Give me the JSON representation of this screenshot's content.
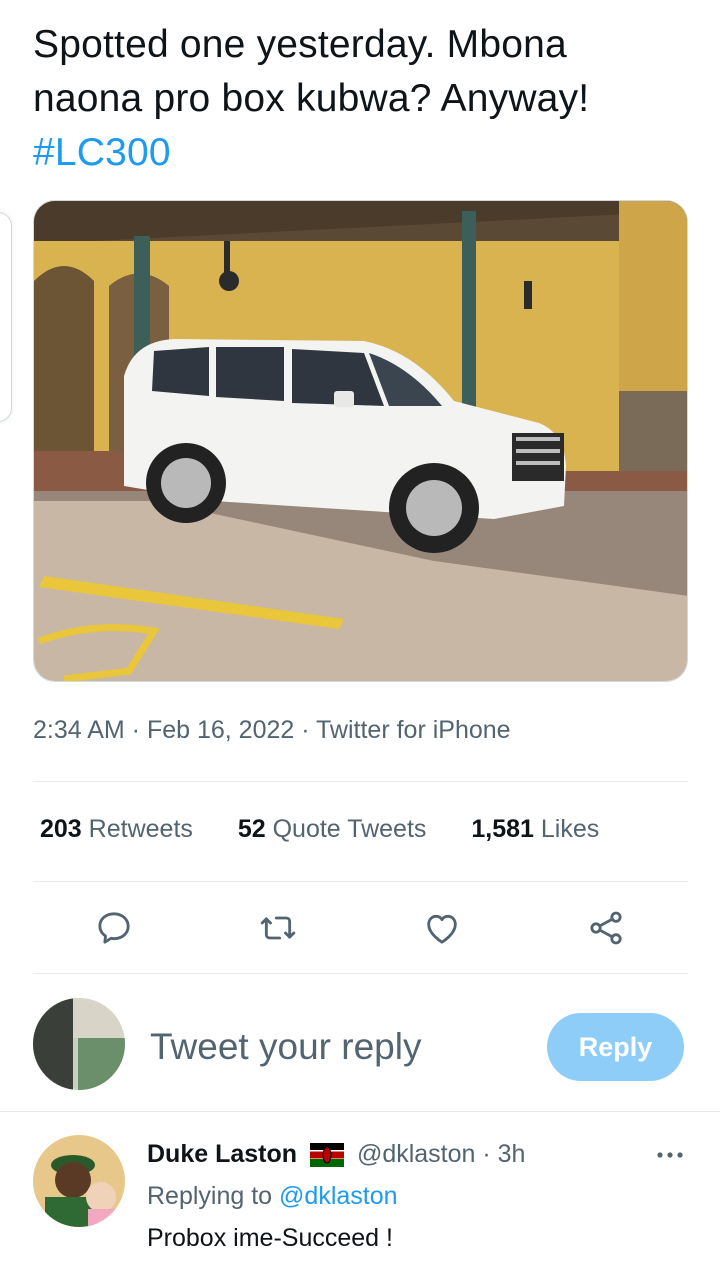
{
  "tweet": {
    "text_line1": "Spotted one yesterday. Mbona",
    "text_line2": "naona pro box kubwa? Anyway!",
    "hashtag": "#LC300",
    "meta": "2:34 AM · Feb 16, 2022 · Twitter for iPhone"
  },
  "stats": {
    "retweets_count": "203",
    "retweets_label": "Retweets",
    "quotes_count": "52",
    "quotes_label": "Quote Tweets",
    "likes_count": "1,581",
    "likes_label": "Likes"
  },
  "actions": {
    "reply_icon": "reply-icon",
    "retweet_icon": "retweet-icon",
    "like_icon": "heart-icon",
    "share_icon": "share-icon"
  },
  "compose": {
    "placeholder": "Tweet your reply",
    "button_label": "Reply"
  },
  "comment": {
    "name": "Duke Laston",
    "handle_time": "@dklaston · 3h",
    "replying_prefix": "Replying to",
    "replying_handle": "@dklaston",
    "text": "Probox ime-Succeed !"
  },
  "colors": {
    "accent": "#1d9bf0",
    "reply_button": "#8ecdf8",
    "secondary_text": "#536471"
  }
}
